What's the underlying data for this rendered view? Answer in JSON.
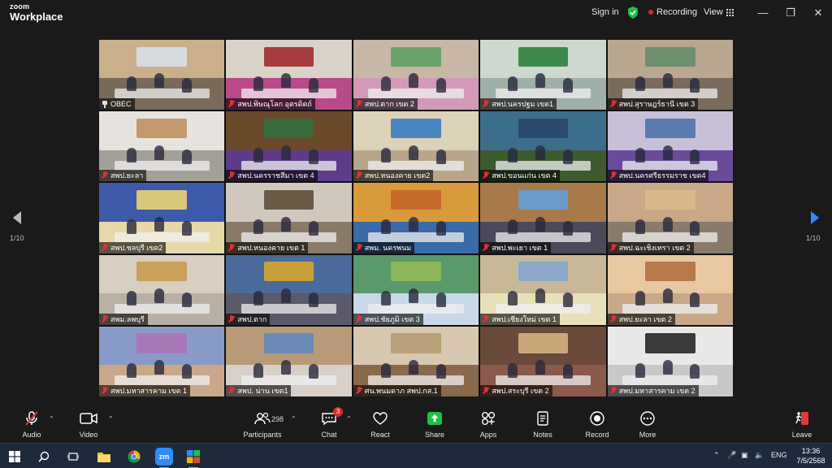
{
  "app": {
    "brand_small": "zoom",
    "brand": "Workplace"
  },
  "titlebar": {
    "signin": "Sign in",
    "recording": "Recording",
    "view": "View"
  },
  "pagination": {
    "left": "1/10",
    "right": "1/10"
  },
  "tiles": [
    {
      "name": "OBEC",
      "pinned": true,
      "active": true,
      "wall": "#c9b08a",
      "floor": "#7a6a5a",
      "screen": "#d7dbe0"
    },
    {
      "name": "สพป.พิษณุโลก อุตรดิตถ์",
      "wall": "#d8d2c8",
      "floor": "#b84a8a",
      "screen": "#a63d3d"
    },
    {
      "name": "สพป.ตาก เขต 2",
      "wall": "#c8b6a6",
      "floor": "#d29ab8",
      "screen": "#6aa36a"
    },
    {
      "name": "สพป.นครปฐม เขต1",
      "wall": "#cfd8cf",
      "floor": "#9fb0a8",
      "screen": "#3f8a4a"
    },
    {
      "name": "สพป.สุราษฎร์ธานี เขต 3",
      "wall": "#b9a78f",
      "floor": "#7a6b5c",
      "screen": "#6d8f6d"
    },
    {
      "name": "สพป.ยะลา",
      "wall": "#e6e3de",
      "floor": "#a3a09a",
      "screen": "#c49a6c"
    },
    {
      "name": "สพป.นครราชสีมา เขต 4",
      "wall": "#6a4a2a",
      "floor": "#5e3c8a",
      "screen": "#3a6a3a"
    },
    {
      "name": "สพป.หนองคาย เขต2",
      "wall": "#dcd2b8",
      "floor": "#b8a58a",
      "screen": "#4a86c0"
    },
    {
      "name": "สพป.ขอนแก่น เขต 4",
      "wall": "#3c6e8c",
      "floor": "#3e5a2e",
      "screen": "#2a4a72"
    },
    {
      "name": "สพป.นครศรีธรรมราช เขต4",
      "wall": "#c8c0d8",
      "floor": "#6a4a9a",
      "screen": "#5b7bb0"
    },
    {
      "name": "สพป.ชลบุรี เขต2",
      "wall": "#3c5aa8",
      "floor": "#e6d8a8",
      "screen": "#d8c878"
    },
    {
      "name": "สพป.หนองคาย เขต 1",
      "wall": "#d0c8bc",
      "floor": "#8a7a68",
      "screen": "#6a5a48"
    },
    {
      "name": "สพม. นครพนม",
      "wall": "#d89a3a",
      "floor": "#3a6aa8",
      "screen": "#c86a2a"
    },
    {
      "name": "สพป.พะเยา เขต 1",
      "wall": "#a87a4a",
      "floor": "#4a4a5a",
      "screen": "#6a9ac8"
    },
    {
      "name": "สพป.ฉะเชิงเทรา เขต 2",
      "wall": "#c8a888",
      "floor": "#8a7a6a",
      "screen": "#d8b88a"
    },
    {
      "name": "สพม.ลพบุรี",
      "wall": "#d8cfc0",
      "floor": "#b8b0a4",
      "screen": "#caa05a"
    },
    {
      "name": "สพป.ตาก",
      "wall": "#4a6a9a",
      "floor": "#5a5a6a",
      "screen": "#c8a03a"
    },
    {
      "name": "สพป.ชัยภูมิ เขต 3",
      "wall": "#5a9a6a",
      "floor": "#c8d8e8",
      "screen": "#8ab858"
    },
    {
      "name": "สพป.เชียงใหม่ เขต 1",
      "wall": "#c8b898",
      "floor": "#e8e0b8",
      "screen": "#8aa8c8"
    },
    {
      "name": "สพป.ยะลา เขต 2",
      "wall": "#e8c8a0",
      "floor": "#c8a888",
      "screen": "#b87a4a"
    },
    {
      "name": "สพป.มหาสารคาม เขต 1",
      "wall": "#8a9ac8",
      "floor": "#c8a888",
      "screen": "#a878b8"
    },
    {
      "name": "สพป. น่าน เขต1",
      "wall": "#b89a78",
      "floor": "#d8d0c8",
      "screen": "#6a8ab8"
    },
    {
      "name": "ศน.พนมดาภ สพป.กส.1",
      "wall": "#d8c8b0",
      "floor": "#8a6a4a",
      "screen": "#b8a078"
    },
    {
      "name": "สพป.สระบุรี เขต 2",
      "wall": "#6a4a3a",
      "floor": "#8a5a4a",
      "screen": "#c8a878"
    },
    {
      "name": "สพป.มหาสารคาม เขต 2",
      "wall": "#e8e8e8",
      "floor": "#c8c8c8",
      "screen": "#3a3a3a"
    }
  ],
  "toolbar": {
    "audio": "Audio",
    "video": "Video",
    "participants": "Participants",
    "participants_count": "298",
    "chat": "Chat",
    "chat_badge": "3",
    "react": "React",
    "share": "Share",
    "apps": "Apps",
    "notes": "Notes",
    "record": "Record",
    "more": "More",
    "leave": "Leave"
  },
  "taskbar": {
    "lang": "ENG",
    "time": "13:36",
    "date": "7/5/2568",
    "zoom_label": "zm"
  },
  "colors": {
    "active_border": "#38d36b",
    "share_green": "#1fbf4a",
    "record_red": "#e02828",
    "leave_red": "#e03a3a"
  }
}
